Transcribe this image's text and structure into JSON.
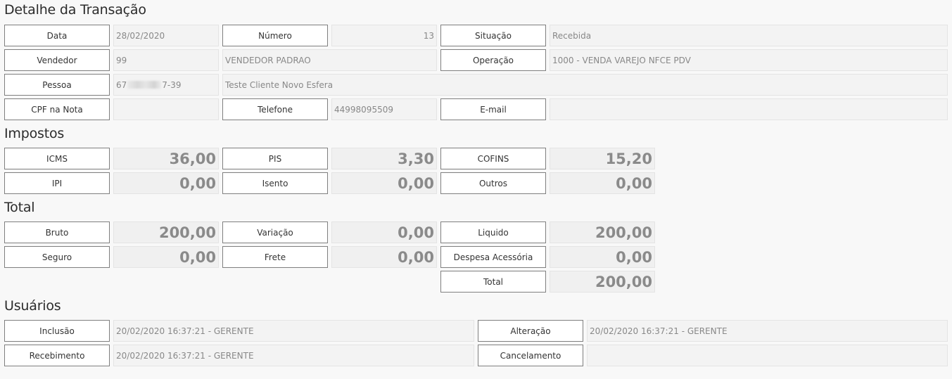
{
  "sections": {
    "detalhe": "Detalhe da Transação",
    "impostos": "Impostos",
    "total": "Total",
    "usuarios": "Usuários"
  },
  "detalhe": {
    "data_label": "Data",
    "data_value": "28/02/2020",
    "numero_label": "Número",
    "numero_value": "13",
    "situacao_label": "Situação",
    "situacao_value": "Recebida",
    "vendedor_label": "Vendedor",
    "vendedor_code": "99",
    "vendedor_name": "VENDEDOR PADRAO",
    "operacao_label": "Operação",
    "operacao_value": "1000 - VENDA VAREJO NFCE PDV",
    "pessoa_label": "Pessoa",
    "pessoa_doc_prefix": "67",
    "pessoa_doc_suffix": "7-39",
    "pessoa_name": "Teste Cliente Novo Esfera",
    "cpf_label": "CPF na Nota",
    "cpf_value": "",
    "telefone_label": "Telefone",
    "telefone_value": "44998095509",
    "email_label": "E-mail",
    "email_value": ""
  },
  "impostos": {
    "icms_label": "ICMS",
    "icms_value": "36,00",
    "pis_label": "PIS",
    "pis_value": "3,30",
    "cofins_label": "COFINS",
    "cofins_value": "15,20",
    "ipi_label": "IPI",
    "ipi_value": "0,00",
    "isento_label": "Isento",
    "isento_value": "0,00",
    "outros_label": "Outros",
    "outros_value": "0,00"
  },
  "total": {
    "bruto_label": "Bruto",
    "bruto_value": "200,00",
    "variacao_label": "Variação",
    "variacao_value": "0,00",
    "liquido_label": "Liquido",
    "liquido_value": "200,00",
    "seguro_label": "Seguro",
    "seguro_value": "0,00",
    "frete_label": "Frete",
    "frete_value": "0,00",
    "despesa_label": "Despesa Acessória",
    "despesa_value": "0,00",
    "total_label": "Total",
    "total_value": "200,00"
  },
  "usuarios": {
    "inclusao_label": "Inclusão",
    "inclusao_value": "20/02/2020 16:37:21 - GERENTE",
    "alteracao_label": "Alteração",
    "alteracao_value": "20/02/2020 16:37:21 - GERENTE",
    "recebimento_label": "Recebimento",
    "recebimento_value": "20/02/2020 16:37:21 - GERENTE",
    "cancelamento_label": "Cancelamento",
    "cancelamento_value": ""
  }
}
